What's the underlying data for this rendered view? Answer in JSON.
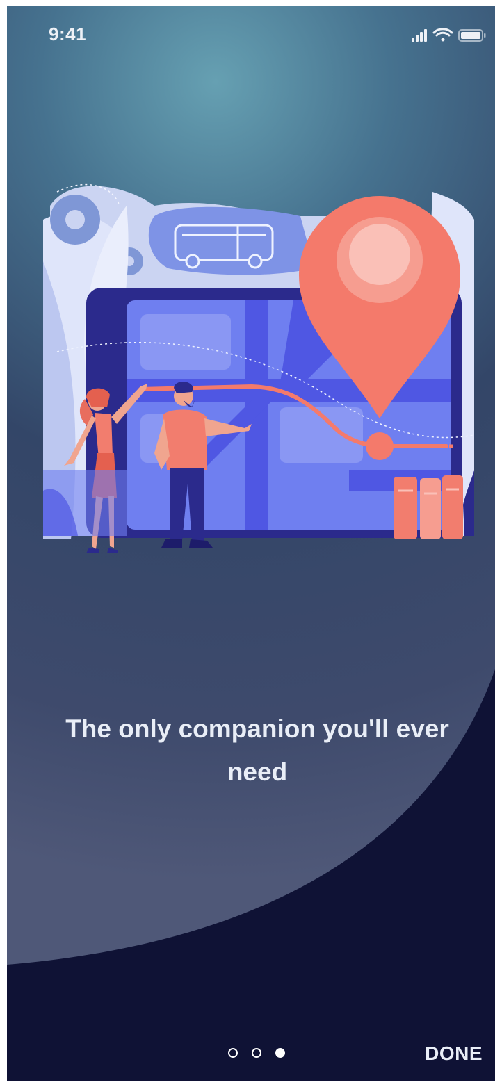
{
  "status_bar": {
    "time": "9:41",
    "icons": [
      "cellular-signal-icon",
      "wifi-icon",
      "battery-icon"
    ]
  },
  "onboarding": {
    "illustration": "map-navigation-illustration",
    "headline": "The only companion you'll ever need",
    "pages_total": 3,
    "current_page": 3
  },
  "actions": {
    "done_label": "DONE"
  },
  "colors": {
    "background_dark": "#0f1235",
    "gradient_top": "#5f97ab",
    "gradient_mid": "#344769",
    "pin": "#f47a6b",
    "map_blue": "#6f7ff0",
    "tablet_frame": "#2b2a8c",
    "text": "#e9eef7"
  }
}
